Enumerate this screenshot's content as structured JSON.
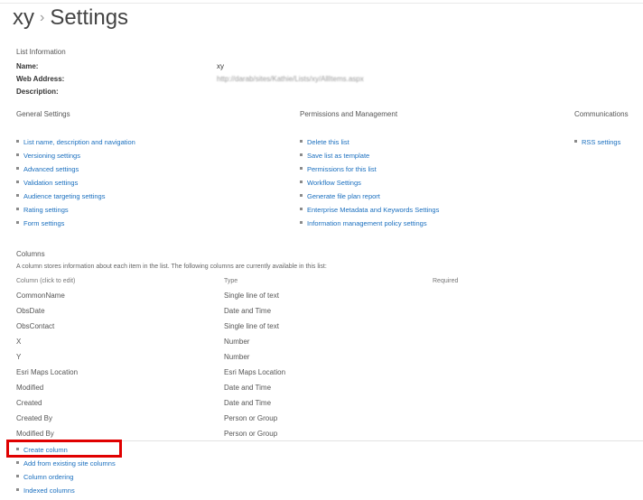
{
  "header": {
    "site": "xy",
    "separator": "›",
    "page": "Settings"
  },
  "list_info": {
    "heading": "List Information",
    "name_label": "Name:",
    "name_value": "xy",
    "web_address_label": "Web Address:",
    "web_address_value": "http://darab/sites/Kathie/Lists/xy/AllItems.aspx",
    "description_label": "Description:"
  },
  "general_settings": {
    "heading": "General Settings",
    "links": [
      "List name, description and navigation",
      "Versioning settings",
      "Advanced settings",
      "Validation settings",
      "Audience targeting settings",
      "Rating settings",
      "Form settings"
    ]
  },
  "permissions": {
    "heading": "Permissions and Management",
    "links": [
      "Delete this list",
      "Save list as template",
      "Permissions for this list",
      "Workflow Settings",
      "Generate file plan report",
      "Enterprise Metadata and Keywords Settings",
      "Information management policy settings"
    ]
  },
  "communications": {
    "heading": "Communications",
    "links": [
      "RSS settings"
    ]
  },
  "columns": {
    "heading": "Columns",
    "description": "A column stores information about each item in the list. The following columns are currently available in this list:",
    "headers": {
      "column": "Column (click to edit)",
      "type": "Type",
      "required": "Required"
    },
    "rows": [
      {
        "name": "CommonName",
        "type": "Single line of text"
      },
      {
        "name": "ObsDate",
        "type": "Date and Time"
      },
      {
        "name": "ObsContact",
        "type": "Single line of text"
      },
      {
        "name": "X",
        "type": "Number"
      },
      {
        "name": "Y",
        "type": "Number"
      },
      {
        "name": "Esri Maps Location",
        "type": "Esri Maps Location"
      },
      {
        "name": "Modified",
        "type": "Date and Time"
      },
      {
        "name": "Created",
        "type": "Date and Time"
      },
      {
        "name": "Created By",
        "type": "Person or Group"
      },
      {
        "name": "Modified By",
        "type": "Person or Group"
      }
    ],
    "actions": [
      "Create column",
      "Add from existing site columns",
      "Column ordering",
      "Indexed columns"
    ]
  },
  "colors": {
    "link": "#1a6fbf",
    "highlight": "#e00000"
  }
}
